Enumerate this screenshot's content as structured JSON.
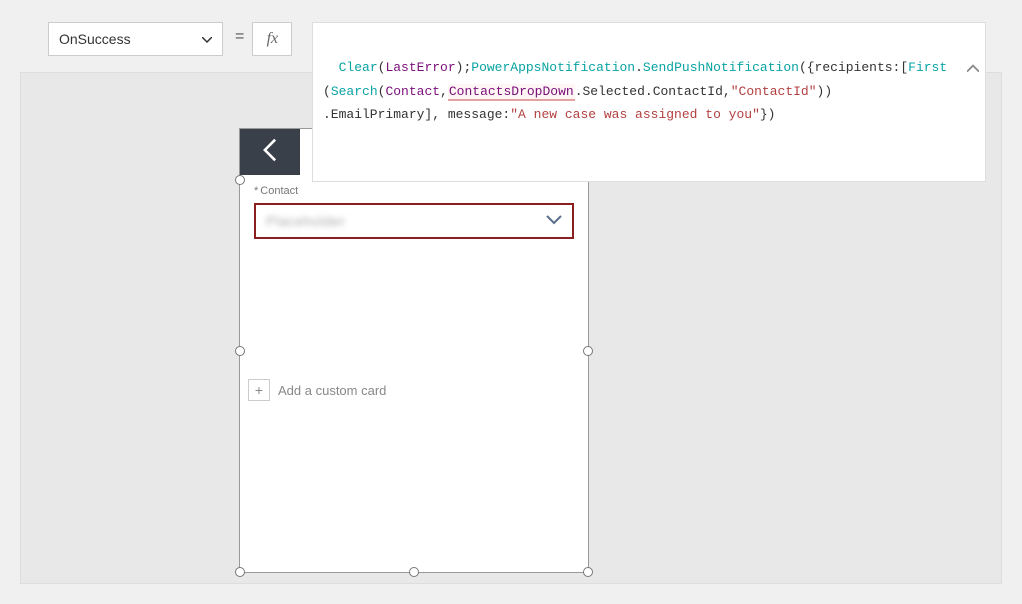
{
  "propertyDropdown": {
    "selected": "OnSuccess"
  },
  "equals": "=",
  "fxLabel": "fx",
  "formula": {
    "tokens": [
      {
        "t": "fn",
        "v": "Clear"
      },
      {
        "t": "plain",
        "v": "("
      },
      {
        "t": "id",
        "v": "LastError"
      },
      {
        "t": "plain",
        "v": ");"
      },
      {
        "t": "fn",
        "v": "PowerAppsNotification"
      },
      {
        "t": "plain",
        "v": "."
      },
      {
        "t": "fn",
        "v": "SendPushNotification"
      },
      {
        "t": "plain",
        "v": "({recipients:["
      },
      {
        "t": "fn",
        "v": "First"
      },
      {
        "t": "plain",
        "v": "\n("
      },
      {
        "t": "fn",
        "v": "Search"
      },
      {
        "t": "plain",
        "v": "("
      },
      {
        "t": "id",
        "v": "Contact"
      },
      {
        "t": "plain",
        "v": ","
      },
      {
        "t": "hl",
        "v": "ContactsDropDown"
      },
      {
        "t": "plain",
        "v": ".Selected.ContactId,"
      },
      {
        "t": "str",
        "v": "\"ContactId\""
      },
      {
        "t": "plain",
        "v": "))\n.EmailPrimary], message:"
      },
      {
        "t": "str",
        "v": "\"A new case was assigned to you\""
      },
      {
        "t": "plain",
        "v": "})"
      }
    ]
  },
  "form": {
    "fieldLabel": "Contact",
    "asterisk": "*",
    "dropdownValue": "Placeholder",
    "addCardLabel": "Add a custom card",
    "plus": "+"
  }
}
